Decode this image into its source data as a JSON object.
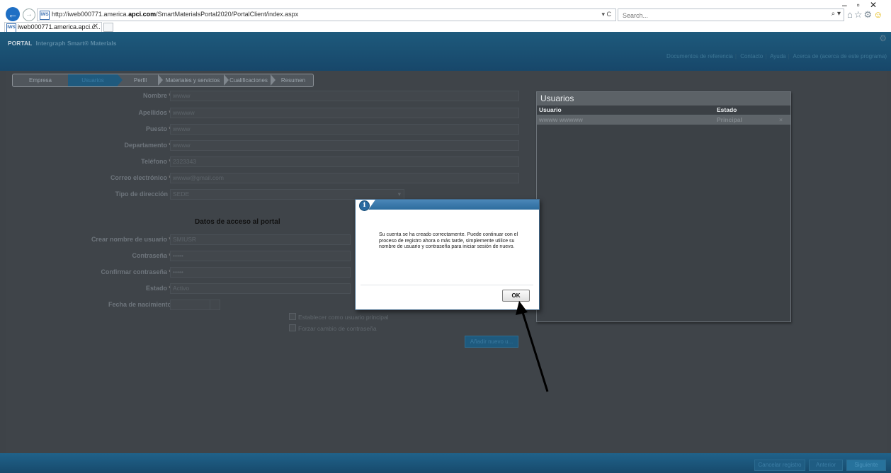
{
  "browser": {
    "url_prefix": "http://iweb000771.america.",
    "url_domain": "apci.com",
    "url_suffix": "/SmartMaterialsPortal2020/PortalClient/index.aspx",
    "refresh_glyph": "▾ C",
    "search_placeholder": "Search...",
    "tab_title": "iweb000771.america.apci.c...",
    "favicon_text": "IWS"
  },
  "portal": {
    "brand_prefix": "PORTAL",
    "brand_name": "Intergraph Smart® Materials",
    "top_links": [
      "Documentos de referencia",
      "Contacto",
      "Ayuda",
      "Acerca de (acerca de este programa)"
    ]
  },
  "wizard": {
    "steps": [
      "Empresa",
      "Usuarios",
      "Perfil",
      "Materiales y servicios",
      "Cualificaciones",
      "Resumen"
    ],
    "active_index": 1
  },
  "form": {
    "fields": [
      {
        "label": "Nombre",
        "value": "wwww"
      },
      {
        "label": "Apellidos",
        "value": "wwwww"
      },
      {
        "label": "Puesto",
        "value": "wwww"
      },
      {
        "label": "Departamento",
        "value": "wwww"
      },
      {
        "label": "Teléfono",
        "value": "2323343"
      },
      {
        "label": "Correo electrónico",
        "value": "wwww@gmail.com"
      },
      {
        "label": "Tipo de dirección",
        "value": "SEDE"
      }
    ],
    "access_title": "Datos de acceso al portal",
    "access_fields": [
      {
        "label": "Crear nombre de usuario",
        "value": "SMIUSR"
      },
      {
        "label": "Contraseña",
        "value": "•••••"
      },
      {
        "label": "Confirmar contraseña",
        "value": "•••••"
      },
      {
        "label": "Estado",
        "value": "Activo"
      },
      {
        "label": "Fecha de nacimiento",
        "value": ""
      }
    ],
    "checks": [
      "Establecer como usuario principal",
      "Forzar cambio de contraseña"
    ],
    "add_button": "Añadir nuevo u..."
  },
  "users_panel": {
    "title": "Usuarios",
    "columns": [
      "Usuario",
      "Estado"
    ],
    "rows": [
      {
        "user": "wwww wwwww",
        "status": "Principal"
      }
    ]
  },
  "footer": {
    "buttons": [
      "Cancelar registro",
      "Anterior",
      "Siguiente"
    ]
  },
  "dialog": {
    "message": "Su cuenta se ha creado correctamente. Puede continuar con el proceso de registro ahora o más tarde, simplemente utilice su nombre de usuario y contraseña para iniciar sesión de nuevo.",
    "ok_label": "OK"
  },
  "colors": {
    "header": "#1e5a7c",
    "overlay": "#3e4348",
    "dialog_title": "#2d6c9e"
  }
}
